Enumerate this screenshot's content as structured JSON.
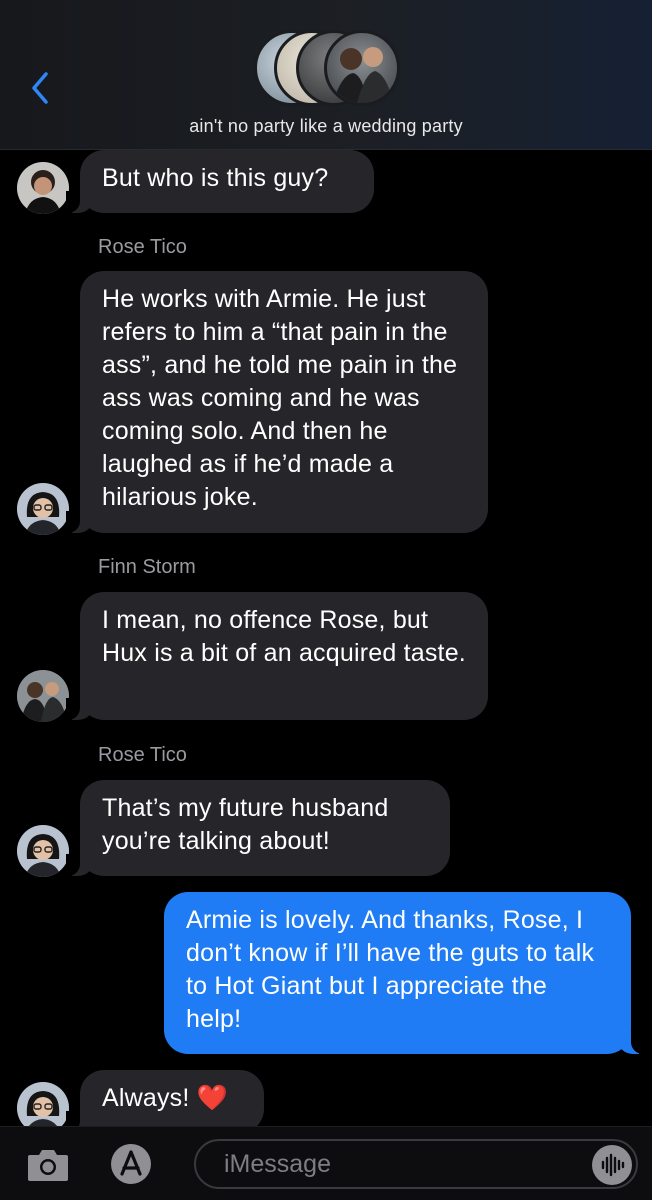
{
  "header": {
    "group_name": "ain't no party like a wedding party",
    "back_icon": "chevron-left-icon",
    "accent_color": "#2f86f6"
  },
  "messages": [
    {
      "sender": "",
      "text": "But who is this guy?",
      "direction": "incoming",
      "avatar": "man-curly-hair-avatar"
    },
    {
      "sender": "Rose Tico",
      "text": "He works with Armie. He just refers to him a “that pain in the ass”, and he told me pain in the ass was coming and he was coming solo. And then he laughed as if he’d made a hilarious joke.",
      "direction": "incoming",
      "avatar": "woman-glasses-avatar"
    },
    {
      "sender": "Finn Storm",
      "text": "I mean, no offence Rose, but Hux is a bit of an acquired taste.",
      "direction": "incoming",
      "avatar": "two-men-avatar"
    },
    {
      "sender": "Rose Tico",
      "text": "That’s my future husband you’re talking about!",
      "direction": "incoming",
      "avatar": "woman-glasses-avatar"
    },
    {
      "sender": "",
      "text": "Armie is lovely. And thanks, Rose, I don’t know if I’ll have the guts to talk to Hot Giant but I appreciate the help!",
      "direction": "outgoing",
      "avatar": ""
    },
    {
      "sender": "",
      "text": "Always!",
      "emoji": "❤️",
      "direction": "incoming",
      "avatar": "woman-glasses-avatar"
    }
  ],
  "input_bar": {
    "placeholder": "iMessage",
    "camera_icon": "camera-icon",
    "apps_icon": "app-store-icon",
    "audio_icon": "audio-waveform-icon"
  },
  "colors": {
    "incoming_bubble": "#26262a",
    "outgoing_bubble": "#1f7cf5",
    "background": "#000000"
  }
}
